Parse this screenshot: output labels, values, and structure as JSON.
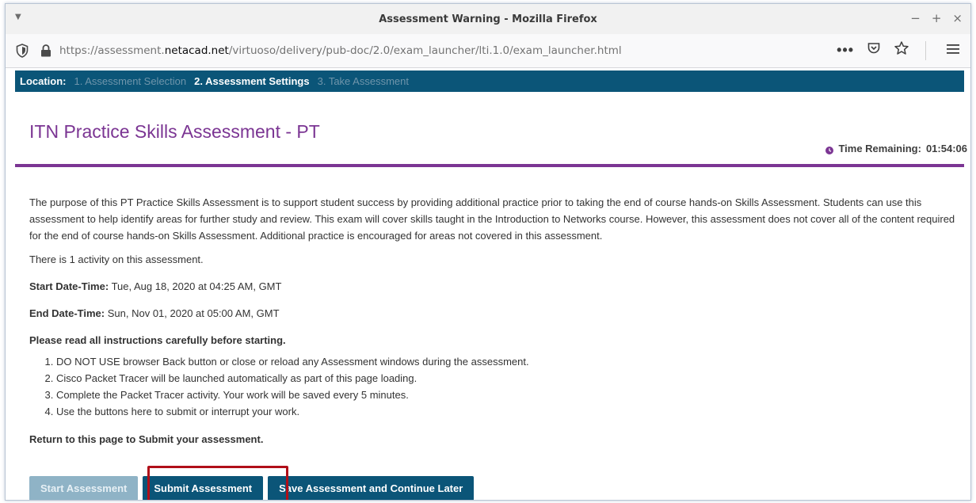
{
  "window": {
    "title": "Assessment Warning - Mozilla Firefox",
    "controls": [
      "−",
      "+",
      "×"
    ]
  },
  "navbar": {
    "url_prefix": "https://assessment.",
    "url_domain": "netacad.net",
    "url_suffix": "/virtuoso/delivery/pub-doc/2.0/exam_launcher/lti.1.0/exam_launcher.html",
    "more": "•••",
    "icons": [
      "shield-icon",
      "lock-icon",
      "pocket-icon",
      "star-icon",
      "hamburger-icon"
    ]
  },
  "location": {
    "label": "Location:",
    "steps": [
      {
        "label": "1. Assessment Selection",
        "active": false
      },
      {
        "label": "2. Assessment Settings",
        "active": true
      },
      {
        "label": "3. Take Assessment",
        "active": false
      }
    ]
  },
  "header": {
    "title": "ITN Practice Skills Assessment - PT",
    "time_label": "Time Remaining:",
    "time_value": "01:54:06"
  },
  "content": {
    "intro": "The purpose of this PT Practice Skills Assessment is to support student success by providing additional practice prior to taking the end of course hands-on Skills Assessment. Students can use this assessment to help identify areas for further study and review. This exam will cover skills taught in the Introduction to Networks course. However, this assessment does not cover all of the content required for the end of course hands-on Skills Assessment. Additional practice is encouraged for areas not covered in this assessment.",
    "activity_count": "There is 1 activity on this assessment.",
    "start_label": "Start Date-Time:",
    "start_value": "Tue, Aug 18, 2020 at 04:25 AM, GMT",
    "end_label": "End Date-Time:",
    "end_value": "Sun, Nov 01, 2020 at 05:00 AM, GMT",
    "instructions_heading": "Please read all instructions carefully before starting.",
    "instructions": [
      "DO NOT USE browser Back button or close or reload any Assessment windows during the assessment.",
      "Cisco Packet Tracer will be launched automatically as part of this page loading.",
      "Complete the Packet Tracer activity. Your work will be saved every 5 minutes.",
      "Use the buttons here to submit or interrupt your work."
    ],
    "return_note": "Return to this page to Submit your assessment."
  },
  "buttons": {
    "start": "Start Assessment",
    "submit": "Submit Assessment",
    "save": "Save Assessment and Continue Later"
  },
  "colors": {
    "brand_blue": "#0b5578",
    "accent_purple": "#7b3593",
    "highlight_red": "#b00f19",
    "disabled_blue": "#8fb3c6"
  }
}
